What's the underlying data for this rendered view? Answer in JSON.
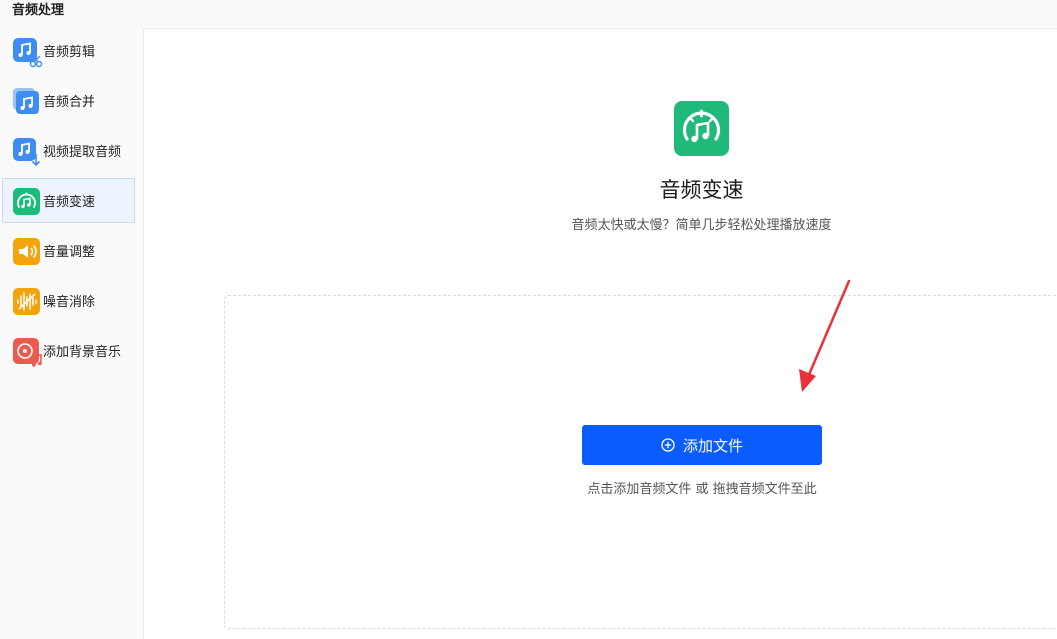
{
  "section_title": "音频处理",
  "sidebar": {
    "items": [
      {
        "label": "音频剪辑",
        "icon": "audio-cut-icon",
        "color": "#3f8cf2",
        "active": false
      },
      {
        "label": "音频合并",
        "icon": "audio-merge-icon",
        "color": "#3f8cf2",
        "active": false
      },
      {
        "label": "视频提取音频",
        "icon": "video-extract-audio-icon",
        "color": "#3f8cf2",
        "active": false
      },
      {
        "label": "音频变速",
        "icon": "audio-speed-icon",
        "color": "#1fba79",
        "active": true
      },
      {
        "label": "音量调整",
        "icon": "volume-icon",
        "color": "#f5a30d",
        "active": false
      },
      {
        "label": "噪音消除",
        "icon": "noise-removal-icon",
        "color": "#f5a30d",
        "active": false
      },
      {
        "label": "添加背景音乐",
        "icon": "background-music-icon",
        "color": "#ee5a4f",
        "active": false
      }
    ]
  },
  "main": {
    "title": "音频变速",
    "subtitle": "音频太快或太慢？简单几步轻松处理播放速度",
    "add_button_label": "添加文件",
    "hint": "点击添加音频文件 或 拖拽音频文件至此"
  },
  "colors": {
    "primary_button": "#0b5cff",
    "accent_green": "#1fba79",
    "annotation_arrow": "#e8313a"
  }
}
